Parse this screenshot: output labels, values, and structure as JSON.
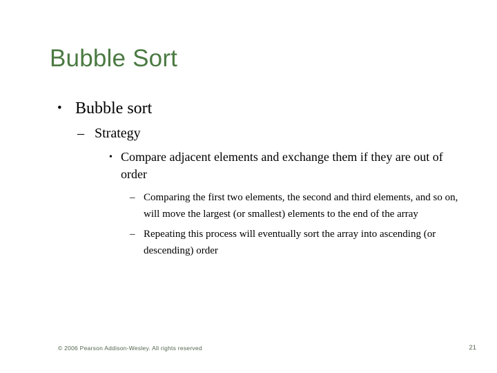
{
  "slide": {
    "title": "Bubble Sort",
    "title_color": "#4b7a42",
    "background_color": "#ffffff",
    "body_text_color": "#000000"
  },
  "content": {
    "level1": {
      "marker": "•",
      "text": "Bubble sort"
    },
    "level2": {
      "marker": "–",
      "text": "Strategy"
    },
    "level3": {
      "marker": "•",
      "text": "Compare adjacent elements and exchange them if they are out of order"
    },
    "level4": [
      {
        "marker": "–",
        "text": "Comparing the first two elements, the second and third elements, and so on, will move the largest (or smallest) elements to the end of the array"
      },
      {
        "marker": "–",
        "text": "Repeating this process will eventually sort the array into ascending (or descending) order"
      }
    ]
  },
  "footer": {
    "copyright": "© 2006 Pearson Addison-Wesley. All rights reserved",
    "page_number": "21",
    "color": "#54684f"
  }
}
